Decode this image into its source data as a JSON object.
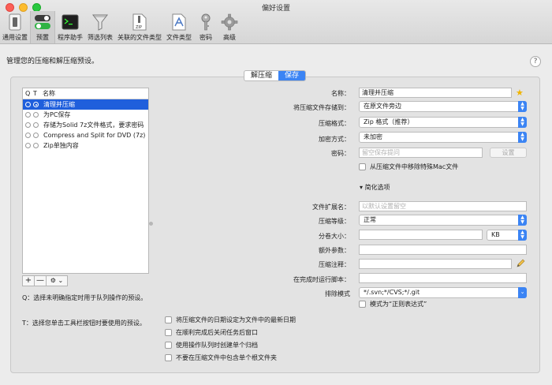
{
  "window": {
    "title": "偏好设置"
  },
  "toolbar": {
    "items": [
      {
        "label": "通用设置",
        "icon": "switch-icon"
      },
      {
        "label": "预置",
        "icon": "toggle-icon"
      },
      {
        "label": "程序助手",
        "icon": "terminal-icon"
      },
      {
        "label": "筛选列表",
        "icon": "funnel-icon"
      },
      {
        "label": "关联的文件类型",
        "icon": "zip-document-icon"
      },
      {
        "label": "文件类型",
        "icon": "document-icon"
      },
      {
        "label": "密码",
        "icon": "key-icon"
      },
      {
        "label": "高级",
        "icon": "gear-icon"
      }
    ],
    "selected": "预置"
  },
  "header": {
    "manage_text": "管理您的压缩和解压缩预设。",
    "help": "?"
  },
  "mode": {
    "decompress": "解压缩",
    "compress": "保存",
    "active": "保存"
  },
  "presets": {
    "headers": {
      "q": "Q",
      "t": "T",
      "name": "名称"
    },
    "items": [
      {
        "name": "清理并压缩",
        "q": false,
        "t": true,
        "selected": true
      },
      {
        "name": "为PC保存",
        "q": false,
        "t": false,
        "selected": false
      },
      {
        "name": "存储为Solid 7z文件格式，要求密码",
        "q": false,
        "t": false,
        "selected": false
      },
      {
        "name": "Compress and Split for DVD (7z)",
        "q": false,
        "t": false,
        "selected": false
      },
      {
        "name": "Zip单独内容",
        "q": false,
        "t": false,
        "selected": false
      }
    ],
    "buttons": {
      "add": "+",
      "remove": "—",
      "action": "⚙ ⌄"
    }
  },
  "notes": {
    "q": "Q：选择未明确指定时用于队列操作的预设。",
    "t": "T：选择您单击工具栏按钮时要使用的预设。"
  },
  "form": {
    "name": {
      "label": "名称：",
      "value": "清理并压缩"
    },
    "save_to": {
      "label": "将压缩文件存储到：",
      "value": "在原文件旁边"
    },
    "format": {
      "label": "压缩格式：",
      "value": "Zip 格式（推荐）"
    },
    "encryption": {
      "label": "加密方式：",
      "value": "未加密"
    },
    "password": {
      "label": "密码：",
      "placeholder": "留空保存提问",
      "button": "设置"
    },
    "remove_mac": "从压缩文件中移除特殊Mac文件",
    "simplify": "简化选项",
    "extension": {
      "label": "文件扩展名：",
      "placeholder": "以默认设置留空"
    },
    "level": {
      "label": "压缩等级：",
      "value": "正常"
    },
    "split": {
      "label": "分卷大小：",
      "value": "",
      "unit": "KB"
    },
    "extra": {
      "label": "额外参数：",
      "value": ""
    },
    "comment": {
      "label": "压缩注释：",
      "value": ""
    },
    "script": {
      "label": "在完成时运行脚本：",
      "value": ""
    },
    "exclude": {
      "label": "排除模式",
      "value": "*/.svn;*/CVS;*/.git"
    },
    "regex": "模式为“正则表达式”"
  },
  "checkboxes": [
    "将压缩文件的日期设定为文件中的最新日期",
    "在顺利完成后关闭任务后窗口",
    "使用操作队列时创建单个归档",
    "不要在压缩文件中包含单个根文件夹"
  ]
}
